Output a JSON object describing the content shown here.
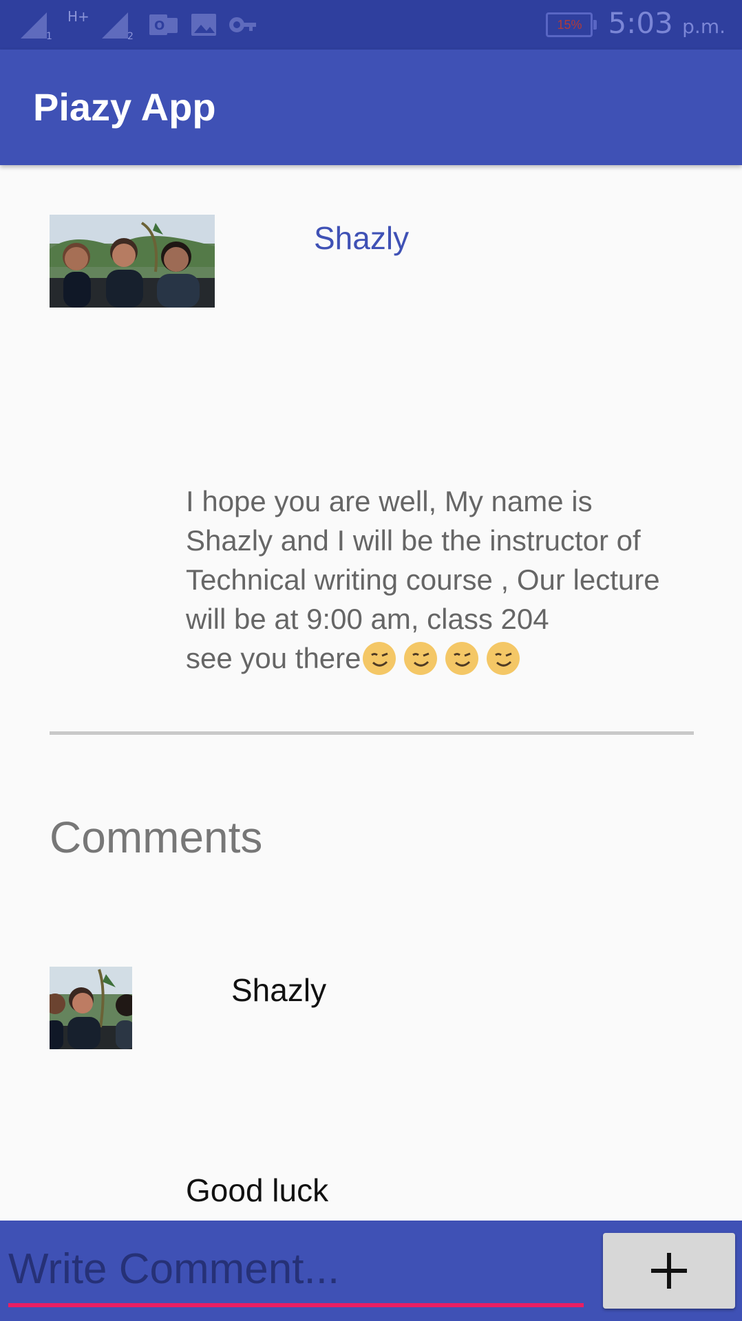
{
  "status_bar": {
    "network_type": "H+",
    "sim_one": "1",
    "sim_two": "2",
    "battery_percent": "15%",
    "time": "5:03",
    "time_period": "p.m.",
    "icons": [
      "signal-icon",
      "signal-icon",
      "outlook-icon",
      "image-icon",
      "key-icon",
      "battery-icon"
    ]
  },
  "app_bar": {
    "title": "Piazy App"
  },
  "post": {
    "author": "Shazly",
    "body_lines": "I hope you are well, My name is\nShazly and I will be the instructor of\nTechnical writing course , Our lecture\nwill be at 9:00 am, class 204\nsee you there",
    "emoji_count": 4
  },
  "comments": {
    "heading": "Comments",
    "items": [
      {
        "author": "Shazly",
        "text": "Good luck"
      }
    ]
  },
  "composer": {
    "placeholder": "Write Comment...",
    "add_label": "+"
  },
  "colors": {
    "status_bar": "#2f3f9e",
    "primary": "#3f51b5",
    "accent": "#e91e63",
    "background": "#fafafa",
    "divider": "#c8c8c8"
  }
}
